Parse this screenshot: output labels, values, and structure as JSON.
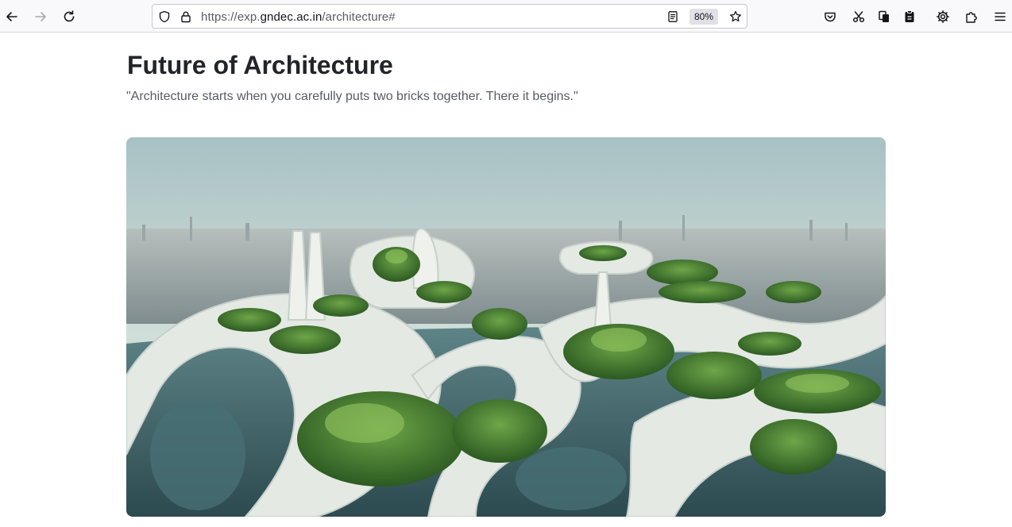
{
  "browser": {
    "url_prefix": "https://exp.",
    "url_host": "gndec.ac.in",
    "url_path": "/architecture#",
    "zoom": "80%",
    "icons": [
      "back-arrow-icon",
      "forward-arrow-icon",
      "reload-icon",
      "shield-icon",
      "lock-icon",
      "reader-view-icon",
      "bookmark-star-icon",
      "pocket-icon",
      "scissors-icon",
      "copy-icon",
      "clipboard-icon",
      "gear-icon",
      "extensions-icon",
      "hamburger-menu-icon"
    ]
  },
  "page": {
    "title": "Future of Architecture",
    "quote": "\"Architecture starts when you carefully puts two bricks together. There it begins.\""
  },
  "colors": {
    "heading": "#212529",
    "quote": "#555d66",
    "sky": "#b9cfcf",
    "structure": "#e3e8e2",
    "greenery": "#3f7a2c",
    "water": "#3b5e62"
  }
}
